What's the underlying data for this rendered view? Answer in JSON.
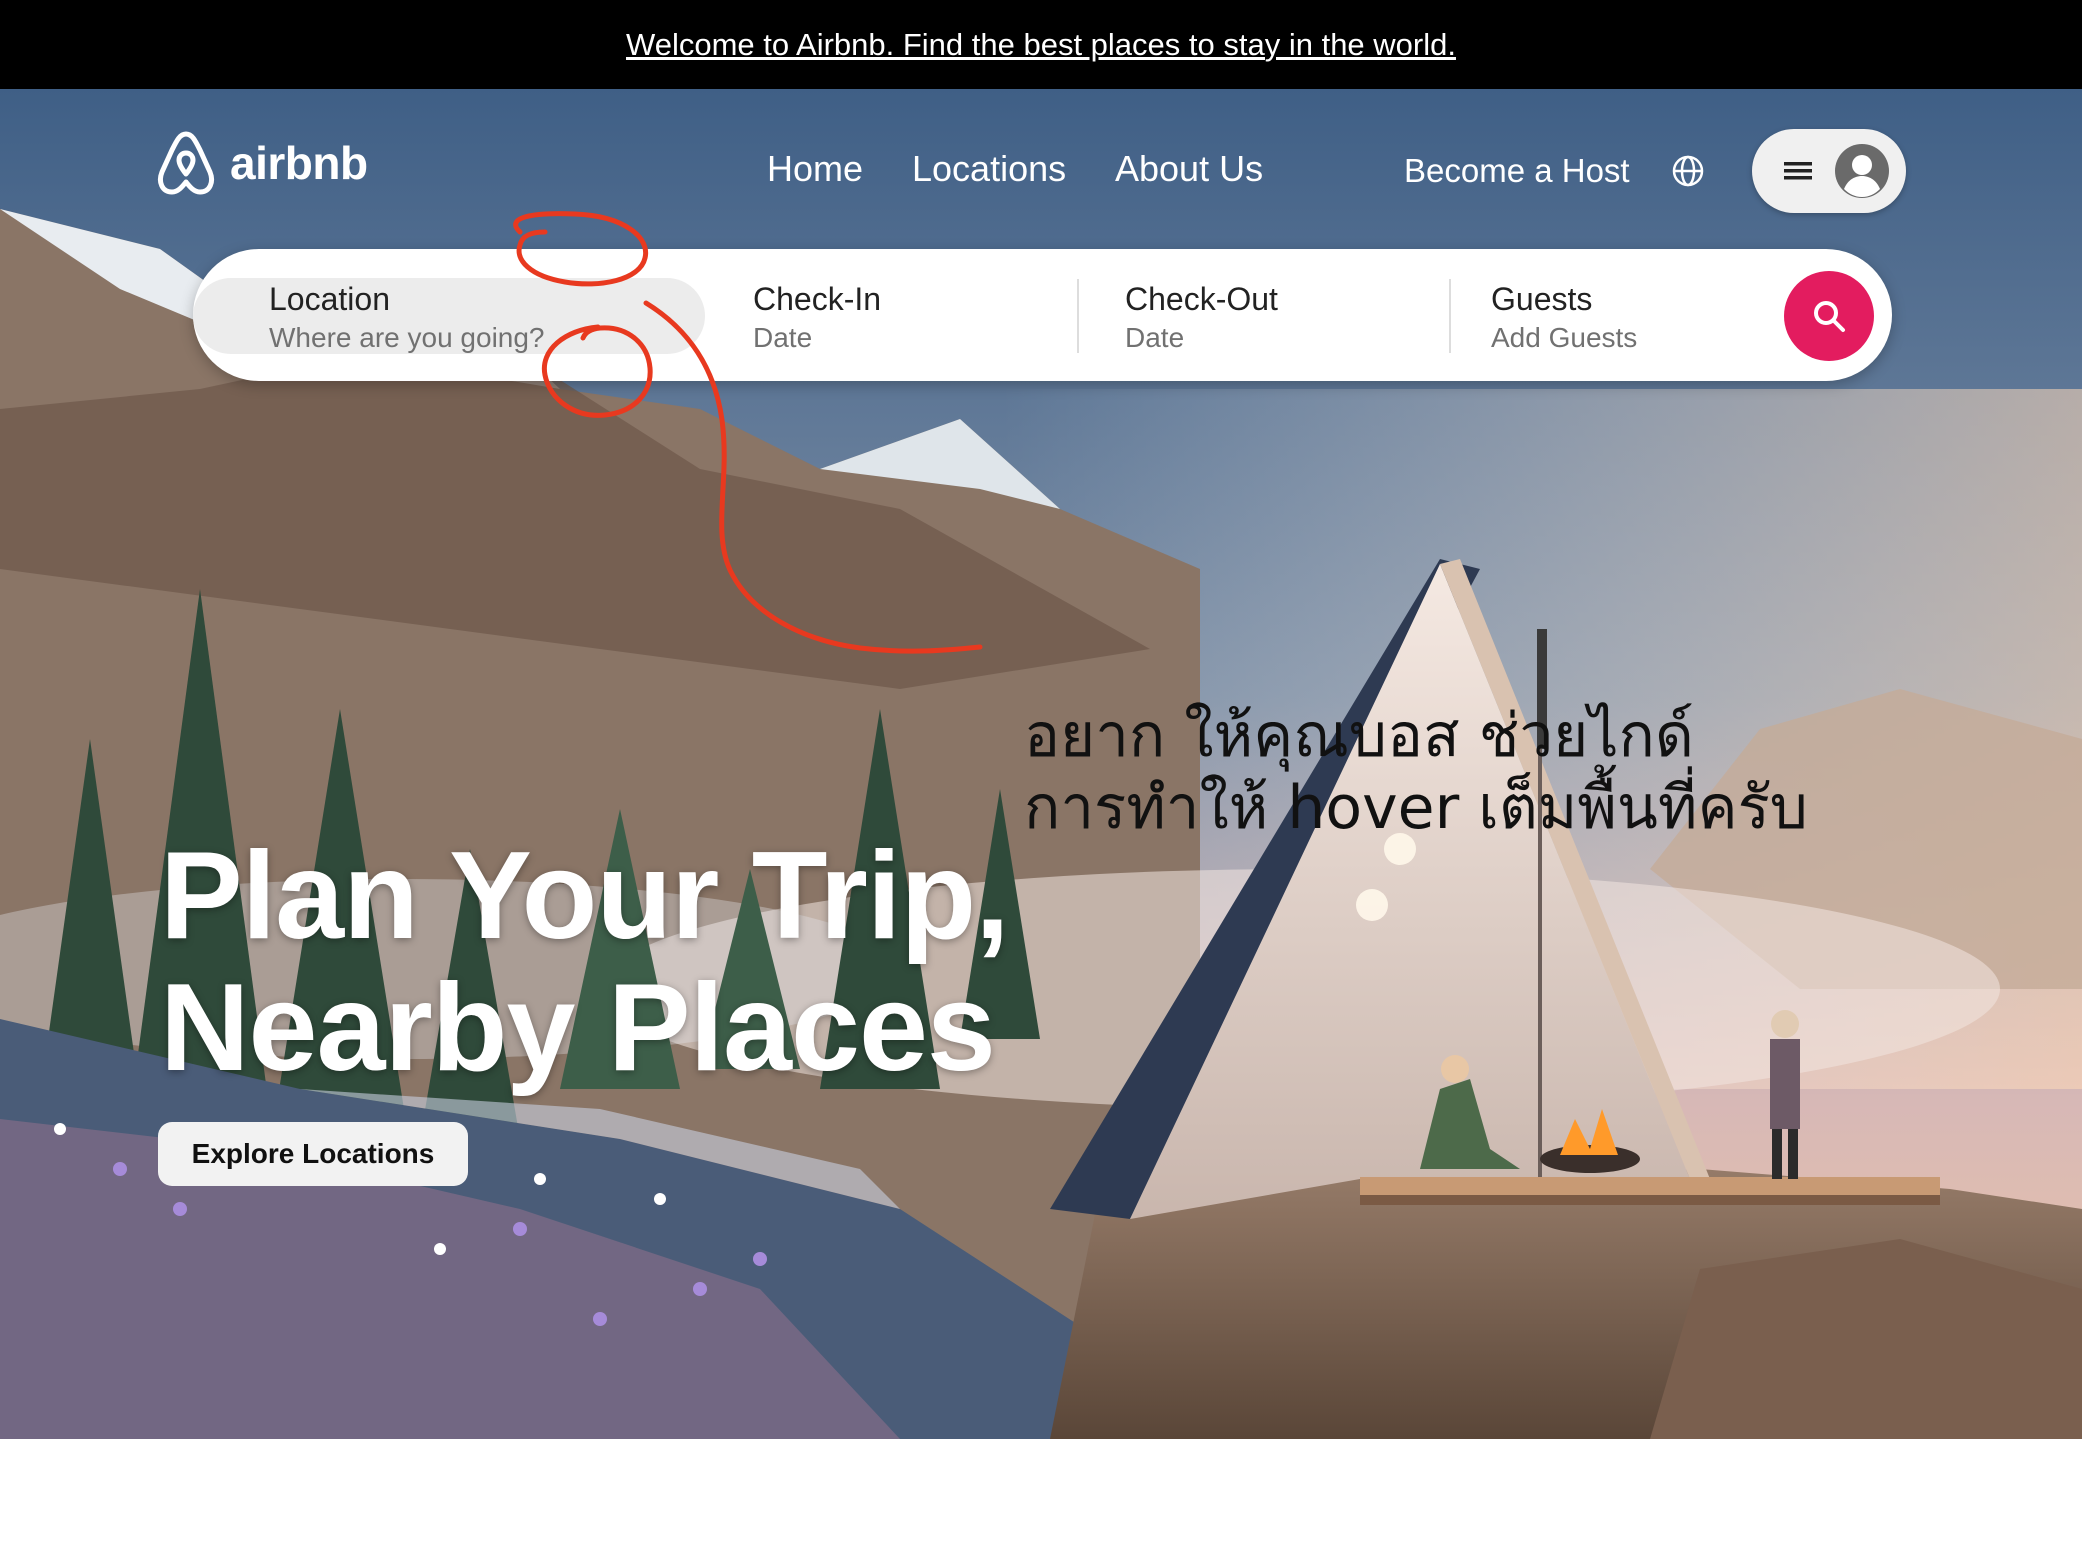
{
  "banner": {
    "text": "Welcome to Airbnb. Find the best places to stay in the world."
  },
  "nav": {
    "logo_text": "airbnb",
    "links": [
      "Home",
      "Locations",
      "About Us"
    ],
    "host_link": "Become a Host",
    "icons": [
      "globe-icon",
      "menu-icon",
      "avatar-icon"
    ]
  },
  "search": {
    "location": {
      "title": "Location",
      "placeholder": "Where are you going?"
    },
    "checkin": {
      "title": "Check-In",
      "placeholder": "Date"
    },
    "checkout": {
      "title": "Check-Out",
      "placeholder": "Date"
    },
    "guests": {
      "title": "Guests",
      "placeholder": "Add Guests"
    },
    "button_icon": "search-icon"
  },
  "hero": {
    "headline_line1": "Plan Your Trip,",
    "headline_line2": "Nearby Places",
    "cta": "Explore Locations"
  },
  "annotation": {
    "note_line1": "อยาก ให้คุณบอส ช่วยไกด์",
    "note_line2": "การทำให้ hover เต็มพื้นที่ครับ"
  },
  "colors": {
    "brand": "#e31c5f",
    "banner_bg": "#000000",
    "annotation": "#e8391f"
  }
}
